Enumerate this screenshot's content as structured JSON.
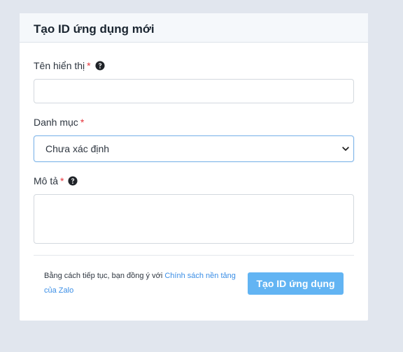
{
  "form": {
    "title": "Tạo ID ứng dụng mới",
    "fields": {
      "display_name": {
        "label": "Tên hiển thị",
        "required_mark": "*",
        "value": "",
        "help_icon": "question-circle-icon"
      },
      "category": {
        "label": "Danh mục",
        "required_mark": "*",
        "selected": "Chưa xác định",
        "dropdown_icon": "chevron-down-icon"
      },
      "description": {
        "label": "Mô tả",
        "required_mark": "*",
        "value": "",
        "help_icon": "question-circle-icon"
      }
    },
    "footer": {
      "terms_prefix": "Bằng cách tiếp tục, bạn đồng ý với",
      "terms_link": "Chính sách nền tảng của Zalo",
      "submit_label": "Tạo ID ứng dụng"
    }
  },
  "colors": {
    "page_background": "#e1e6ee",
    "required": "#e5343a",
    "link": "#3a8ee6",
    "primary_button": "#62b4f3",
    "select_focus_border": "#7fb5e8"
  }
}
